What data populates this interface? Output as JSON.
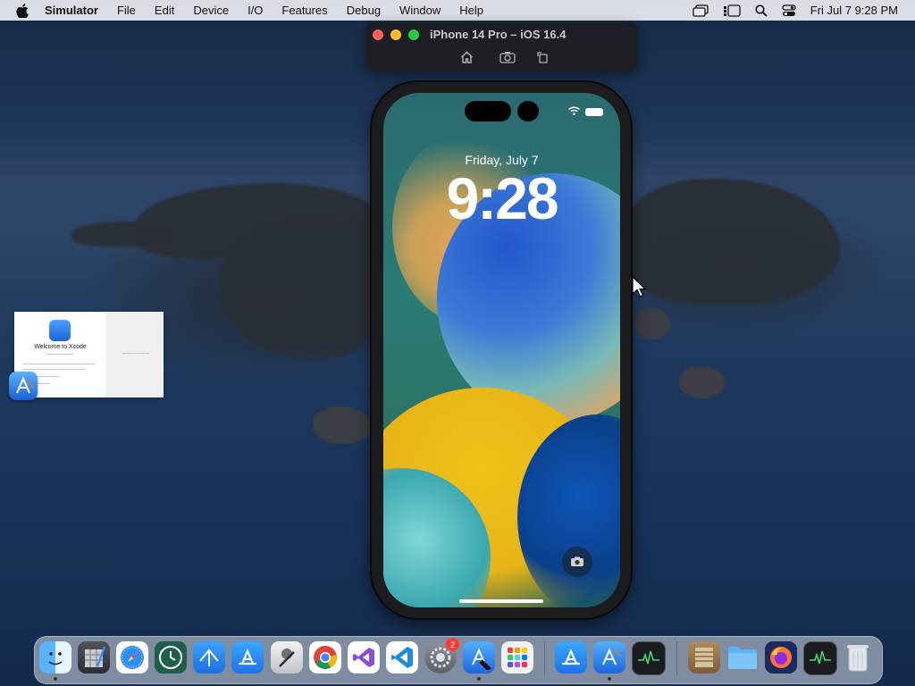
{
  "menubar": {
    "app_name": "Simulator",
    "menus": [
      "File",
      "Edit",
      "Device",
      "I/O",
      "Features",
      "Debug",
      "Window",
      "Help"
    ],
    "clock": "Fri Jul 7  9:28 PM"
  },
  "simulator": {
    "window_title": "iPhone 14 Pro – iOS 16.4",
    "toolbar": [
      "home-icon",
      "screenshot-icon",
      "rotate-icon"
    ]
  },
  "lockscreen": {
    "date": "Friday, July 7",
    "time": "9:28"
  },
  "xcode_welcome": {
    "title": "Welcome to Xcode"
  },
  "dock": {
    "apps": [
      "Finder",
      "Xcode Instruments",
      "Safari",
      "Time Machine",
      "Xcode Build",
      "App Store",
      "Utility",
      "Chrome",
      "Visual Studio",
      "VS Code",
      "System Settings",
      "Xcode",
      "Launchpad",
      "App Store",
      "Xcode",
      "Activity Monitor",
      "Archive",
      "Folder",
      "Firefox",
      "Activity Monitor",
      "Trash"
    ],
    "settings_badge": "2"
  },
  "colors": {
    "menubar_bg": "#eceef2",
    "window_dark": "#1c1e22",
    "lock_text": "#ffffff",
    "badge_red": "#ff3b30"
  }
}
